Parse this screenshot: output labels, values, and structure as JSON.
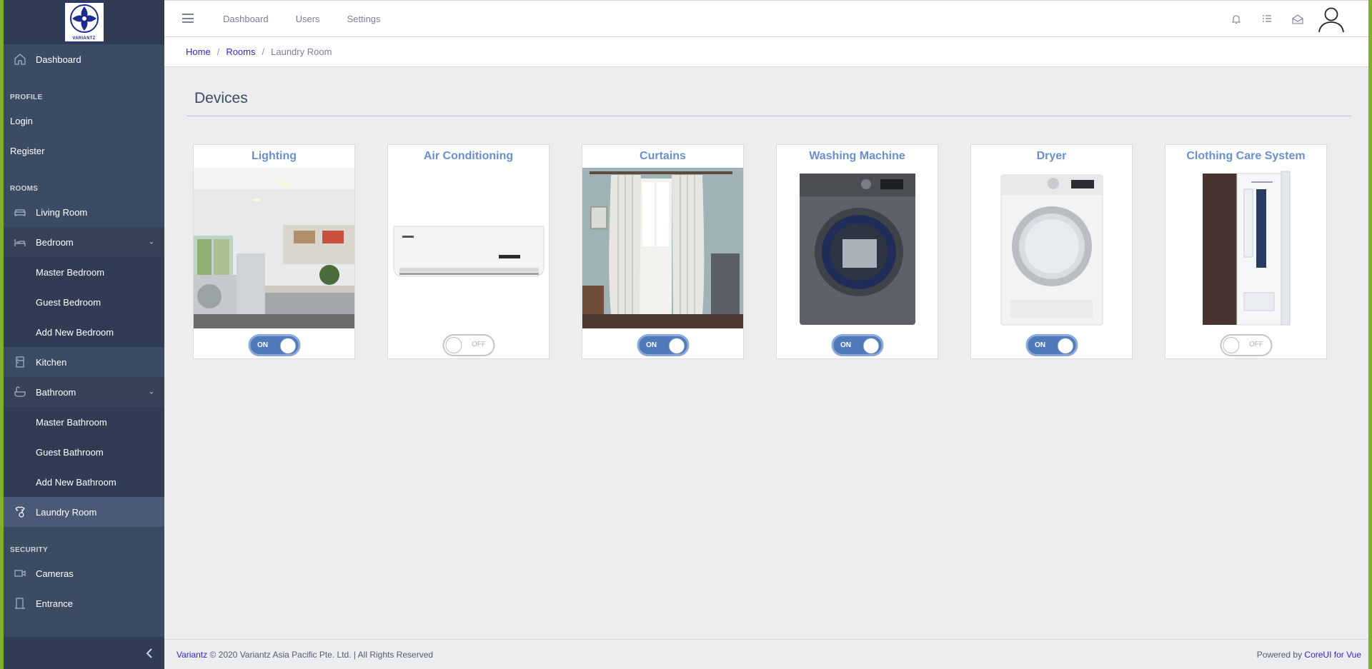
{
  "brand": {
    "logo_text": "VARIANTZ"
  },
  "sidebar": {
    "dashboard": "Dashboard",
    "sections": {
      "profile": "PROFILE",
      "rooms": "ROOMS",
      "security": "SECURITY"
    },
    "profile_items": [
      "Login",
      "Register"
    ],
    "rooms": {
      "living_room": "Living Room",
      "bedroom": "Bedroom",
      "bedroom_sub": [
        "Master Bedroom",
        "Guest Bedroom",
        "Add New Bedroom"
      ],
      "kitchen": "Kitchen",
      "bathroom": "Bathroom",
      "bathroom_sub": [
        "Master Bathroom",
        "Guest Bathroom",
        "Add New Bathroom"
      ],
      "laundry_room": "Laundry Room"
    },
    "security_items": {
      "cameras": "Cameras",
      "entrance": "Entrance"
    }
  },
  "header": {
    "nav": [
      "Dashboard",
      "Users",
      "Settings"
    ]
  },
  "breadcrumb": {
    "home": "Home",
    "rooms": "Rooms",
    "current": "Laundry Room"
  },
  "main": {
    "title": "Devices",
    "devices": [
      {
        "name": "Lighting",
        "state": "ON"
      },
      {
        "name": "Air Conditioning",
        "state": "OFF"
      },
      {
        "name": "Curtains",
        "state": "ON"
      },
      {
        "name": "Washing Machine",
        "state": "ON"
      },
      {
        "name": "Dryer",
        "state": "ON"
      },
      {
        "name": "Clothing Care System",
        "state": "OFF"
      }
    ]
  },
  "footer": {
    "brand_link": "Variantz",
    "copyright": "© 2020 Variantz Asia Pacific Pte. Ltd. | All Rights Reserved",
    "powered_by": "Powered by",
    "powered_link": "CoreUI for Vue"
  },
  "colors": {
    "sidebar_bg": "#3c4b64",
    "accent_green": "#7fb027",
    "toggle_on": "#4f79b8",
    "link": "#321fdb",
    "card_title": "#6a8fd0"
  }
}
